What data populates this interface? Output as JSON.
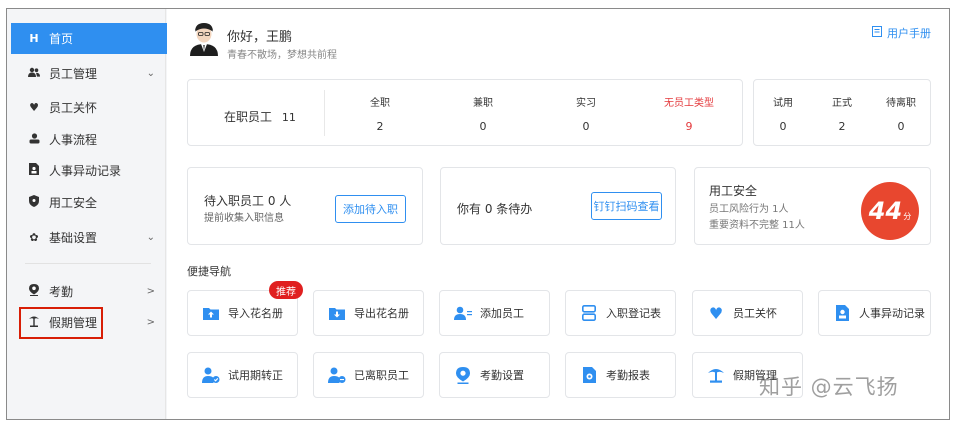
{
  "sidebar": {
    "items": [
      {
        "label": "首页",
        "icon": "home-icon",
        "active": true
      },
      {
        "label": "员工管理",
        "icon": "users-icon",
        "arrow": "⌄"
      },
      {
        "label": "员工关怀",
        "icon": "heart-icon"
      },
      {
        "label": "人事流程",
        "icon": "person-icon"
      },
      {
        "label": "人事异动记录",
        "icon": "doc-person-icon"
      },
      {
        "label": "用工安全",
        "icon": "shield-icon"
      },
      {
        "label": "基础设置",
        "icon": "gear-icon",
        "arrow": "⌄"
      },
      {
        "label": "考勤",
        "icon": "location-pin-icon",
        "arrow": ">"
      },
      {
        "label": "假期管理",
        "icon": "palm-tree-icon",
        "arrow": ">"
      }
    ]
  },
  "header": {
    "greeting": "你好，王鹏",
    "motto": "青春不散场，梦想共前程",
    "manual_label": "用户手册"
  },
  "stats": {
    "onjob_label": "在职员工",
    "onjob_count": "11",
    "types": [
      {
        "label": "全职",
        "value": "2"
      },
      {
        "label": "兼职",
        "value": "0"
      },
      {
        "label": "实习",
        "value": "0"
      },
      {
        "label": "无员工类型",
        "value": "9"
      }
    ],
    "status": [
      {
        "label": "试用",
        "value": "0"
      },
      {
        "label": "正式",
        "value": "2"
      },
      {
        "label": "待离职",
        "value": "0"
      }
    ]
  },
  "tasks": {
    "pending": {
      "title": "待入职员工 0 人",
      "sub": "提前收集入职信息",
      "button": "添加待入职"
    },
    "todo": {
      "title": "你有 0 条待办",
      "button": "钉钉扫码查看"
    },
    "safety": {
      "title": "用工安全",
      "line1": "员工风险行为 1人",
      "line2": "重要资料不完整 11人",
      "score": "44",
      "score_unit": "分"
    }
  },
  "quick": {
    "title": "便捷导航",
    "badge": "推荐",
    "items": [
      {
        "label": "导入花名册",
        "icon": "import-folder-icon"
      },
      {
        "label": "导出花名册",
        "icon": "export-folder-icon"
      },
      {
        "label": "添加员工",
        "icon": "add-user-icon"
      },
      {
        "label": "入职登记表",
        "icon": "register-form-icon"
      },
      {
        "label": "员工关怀",
        "icon": "heart-icon"
      },
      {
        "label": "人事异动记录",
        "icon": "doc-person-icon"
      },
      {
        "label": "试用期转正",
        "icon": "user-check-icon"
      },
      {
        "label": "已离职员工",
        "icon": "user-leave-icon"
      },
      {
        "label": "考勤设置",
        "icon": "location-pin-icon"
      },
      {
        "label": "考勤报表",
        "icon": "report-icon"
      },
      {
        "label": "假期管理",
        "icon": "palm-tree-icon"
      }
    ]
  },
  "watermark": "知乎 @云飞扬",
  "colors": {
    "accent": "#2f8ff0",
    "danger": "#e4393c",
    "score_bg": "#e8472f",
    "highlight_box": "#d81e06"
  }
}
